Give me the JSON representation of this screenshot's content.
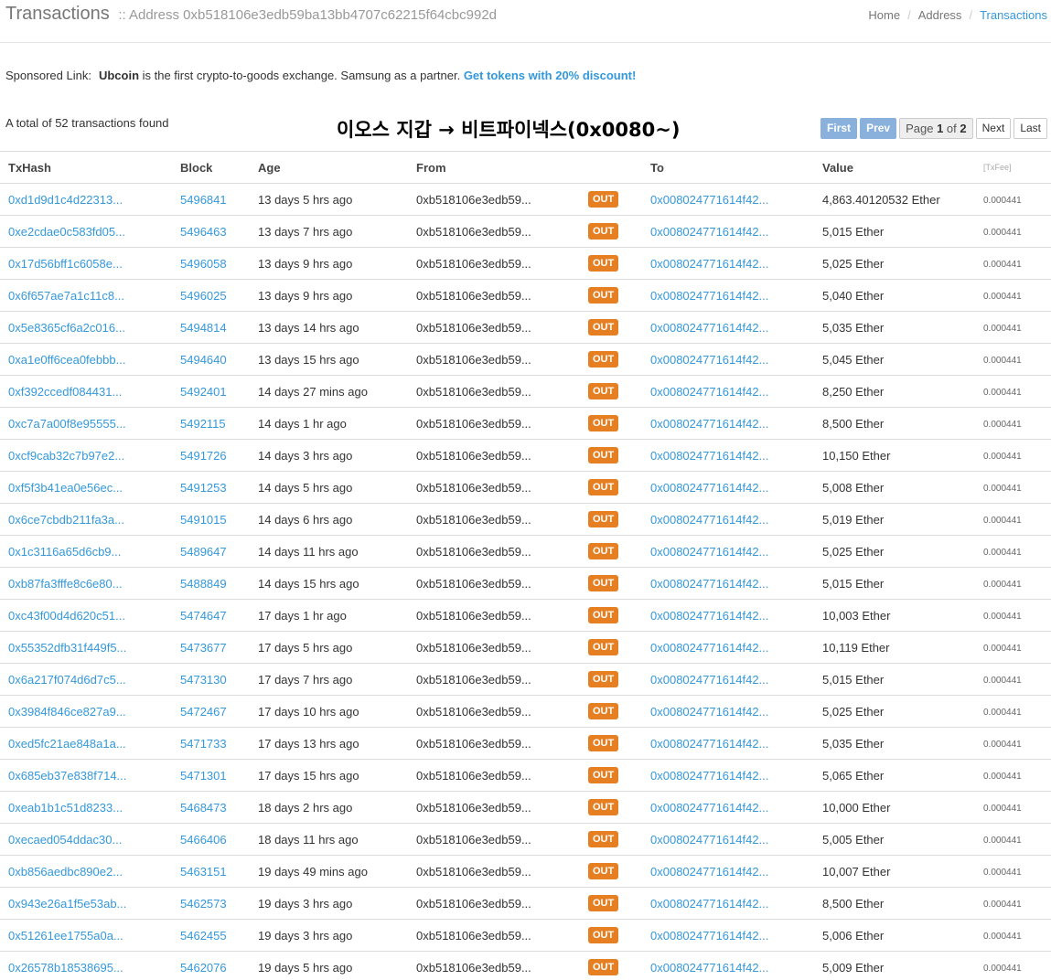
{
  "header": {
    "title": "Transactions",
    "subtitle": ":: Address 0xb518106e3edb59ba13bb4707c62215f64cbc992d",
    "breadcrumb": [
      "Home",
      "Address",
      "Transactions"
    ]
  },
  "sponsor": {
    "label": "Sponsored Link:",
    "brand": "Ubcoin",
    "text": " is the first crypto-to-goods exchange. Samsung as a partner. ",
    "link": "Get tokens with 20% discount!"
  },
  "summary": {
    "total_text": "A total of 52 transactions found"
  },
  "annotation": "이오스 지갑 → 비트파이넥스(0x0080~)",
  "pagination": {
    "first": "First",
    "prev": "Prev",
    "page_label": "Page ",
    "page_current": "1",
    "page_of": " of ",
    "page_total": "2",
    "next": "Next",
    "last": "Last"
  },
  "colors": {
    "link": "#3498db",
    "out_badge": "#e67e22",
    "pager_active": "#8ab1dc"
  },
  "table": {
    "columns": [
      "TxHash",
      "Block",
      "Age",
      "From",
      "",
      "To",
      "Value",
      "[TxFee]"
    ],
    "rows": [
      {
        "hash": "0xd1d9d1c4d22313...",
        "block": "5496841",
        "age": "13 days 5 hrs ago",
        "from": "0xb518106e3edb59...",
        "dir": "OUT",
        "to": "0x008024771614f42...",
        "value": "4,863.40120532 Ether",
        "fee": "0.000441"
      },
      {
        "hash": "0xe2cdae0c583fd05...",
        "block": "5496463",
        "age": "13 days 7 hrs ago",
        "from": "0xb518106e3edb59...",
        "dir": "OUT",
        "to": "0x008024771614f42...",
        "value": "5,015 Ether",
        "fee": "0.000441"
      },
      {
        "hash": "0x17d56bff1c6058e...",
        "block": "5496058",
        "age": "13 days 9 hrs ago",
        "from": "0xb518106e3edb59...",
        "dir": "OUT",
        "to": "0x008024771614f42...",
        "value": "5,025 Ether",
        "fee": "0.000441"
      },
      {
        "hash": "0x6f657ae7a1c11c8...",
        "block": "5496025",
        "age": "13 days 9 hrs ago",
        "from": "0xb518106e3edb59...",
        "dir": "OUT",
        "to": "0x008024771614f42...",
        "value": "5,040 Ether",
        "fee": "0.000441"
      },
      {
        "hash": "0x5e8365cf6a2c016...",
        "block": "5494814",
        "age": "13 days 14 hrs ago",
        "from": "0xb518106e3edb59...",
        "dir": "OUT",
        "to": "0x008024771614f42...",
        "value": "5,035 Ether",
        "fee": "0.000441"
      },
      {
        "hash": "0xa1e0ff6cea0febbb...",
        "block": "5494640",
        "age": "13 days 15 hrs ago",
        "from": "0xb518106e3edb59...",
        "dir": "OUT",
        "to": "0x008024771614f42...",
        "value": "5,045 Ether",
        "fee": "0.000441"
      },
      {
        "hash": "0xf392ccedf084431...",
        "block": "5492401",
        "age": "14 days 27 mins ago",
        "from": "0xb518106e3edb59...",
        "dir": "OUT",
        "to": "0x008024771614f42...",
        "value": "8,250 Ether",
        "fee": "0.000441"
      },
      {
        "hash": "0xc7a7a00f8e95555...",
        "block": "5492115",
        "age": "14 days 1 hr ago",
        "from": "0xb518106e3edb59...",
        "dir": "OUT",
        "to": "0x008024771614f42...",
        "value": "8,500 Ether",
        "fee": "0.000441"
      },
      {
        "hash": "0xcf9cab32c7b97e2...",
        "block": "5491726",
        "age": "14 days 3 hrs ago",
        "from": "0xb518106e3edb59...",
        "dir": "OUT",
        "to": "0x008024771614f42...",
        "value": "10,150 Ether",
        "fee": "0.000441"
      },
      {
        "hash": "0xf5f3b41ea0e56ec...",
        "block": "5491253",
        "age": "14 days 5 hrs ago",
        "from": "0xb518106e3edb59...",
        "dir": "OUT",
        "to": "0x008024771614f42...",
        "value": "5,008 Ether",
        "fee": "0.000441"
      },
      {
        "hash": "0x6ce7cbdb211fa3a...",
        "block": "5491015",
        "age": "14 days 6 hrs ago",
        "from": "0xb518106e3edb59...",
        "dir": "OUT",
        "to": "0x008024771614f42...",
        "value": "5,019 Ether",
        "fee": "0.000441"
      },
      {
        "hash": "0x1c3116a65d6cb9...",
        "block": "5489647",
        "age": "14 days 11 hrs ago",
        "from": "0xb518106e3edb59...",
        "dir": "OUT",
        "to": "0x008024771614f42...",
        "value": "5,025 Ether",
        "fee": "0.000441"
      },
      {
        "hash": "0xb87fa3fffe8c6e80...",
        "block": "5488849",
        "age": "14 days 15 hrs ago",
        "from": "0xb518106e3edb59...",
        "dir": "OUT",
        "to": "0x008024771614f42...",
        "value": "5,015 Ether",
        "fee": "0.000441"
      },
      {
        "hash": "0xc43f00d4d620c51...",
        "block": "5474647",
        "age": "17 days 1 hr ago",
        "from": "0xb518106e3edb59...",
        "dir": "OUT",
        "to": "0x008024771614f42...",
        "value": "10,003 Ether",
        "fee": "0.000441"
      },
      {
        "hash": "0x55352dfb31f449f5...",
        "block": "5473677",
        "age": "17 days 5 hrs ago",
        "from": "0xb518106e3edb59...",
        "dir": "OUT",
        "to": "0x008024771614f42...",
        "value": "10,119 Ether",
        "fee": "0.000441"
      },
      {
        "hash": "0x6a217f074d6d7c5...",
        "block": "5473130",
        "age": "17 days 7 hrs ago",
        "from": "0xb518106e3edb59...",
        "dir": "OUT",
        "to": "0x008024771614f42...",
        "value": "5,015 Ether",
        "fee": "0.000441"
      },
      {
        "hash": "0x3984f846ce827a9...",
        "block": "5472467",
        "age": "17 days 10 hrs ago",
        "from": "0xb518106e3edb59...",
        "dir": "OUT",
        "to": "0x008024771614f42...",
        "value": "5,025 Ether",
        "fee": "0.000441"
      },
      {
        "hash": "0xed5fc21ae848a1a...",
        "block": "5471733",
        "age": "17 days 13 hrs ago",
        "from": "0xb518106e3edb59...",
        "dir": "OUT",
        "to": "0x008024771614f42...",
        "value": "5,035 Ether",
        "fee": "0.000441"
      },
      {
        "hash": "0x685eb37e838f714...",
        "block": "5471301",
        "age": "17 days 15 hrs ago",
        "from": "0xb518106e3edb59...",
        "dir": "OUT",
        "to": "0x008024771614f42...",
        "value": "5,065 Ether",
        "fee": "0.000441"
      },
      {
        "hash": "0xeab1b1c51d8233...",
        "block": "5468473",
        "age": "18 days 2 hrs ago",
        "from": "0xb518106e3edb59...",
        "dir": "OUT",
        "to": "0x008024771614f42...",
        "value": "10,000 Ether",
        "fee": "0.000441"
      },
      {
        "hash": "0xecaed054ddac30...",
        "block": "5466406",
        "age": "18 days 11 hrs ago",
        "from": "0xb518106e3edb59...",
        "dir": "OUT",
        "to": "0x008024771614f42...",
        "value": "5,005 Ether",
        "fee": "0.000441"
      },
      {
        "hash": "0xb856aedbc890e2...",
        "block": "5463151",
        "age": "19 days 49 mins ago",
        "from": "0xb518106e3edb59...",
        "dir": "OUT",
        "to": "0x008024771614f42...",
        "value": "10,007 Ether",
        "fee": "0.000441"
      },
      {
        "hash": "0x943e26a1f5e53ab...",
        "block": "5462573",
        "age": "19 days 3 hrs ago",
        "from": "0xb518106e3edb59...",
        "dir": "OUT",
        "to": "0x008024771614f42...",
        "value": "8,500 Ether",
        "fee": "0.000441"
      },
      {
        "hash": "0x51261ee1755a0a...",
        "block": "5462455",
        "age": "19 days 3 hrs ago",
        "from": "0xb518106e3edb59...",
        "dir": "OUT",
        "to": "0x008024771614f42...",
        "value": "5,006 Ether",
        "fee": "0.000441"
      },
      {
        "hash": "0x26578b18538695...",
        "block": "5462076",
        "age": "19 days 5 hrs ago",
        "from": "0xb518106e3edb59...",
        "dir": "OUT",
        "to": "0x008024771614f42...",
        "value": "5,009 Ether",
        "fee": "0.000441"
      }
    ]
  }
}
